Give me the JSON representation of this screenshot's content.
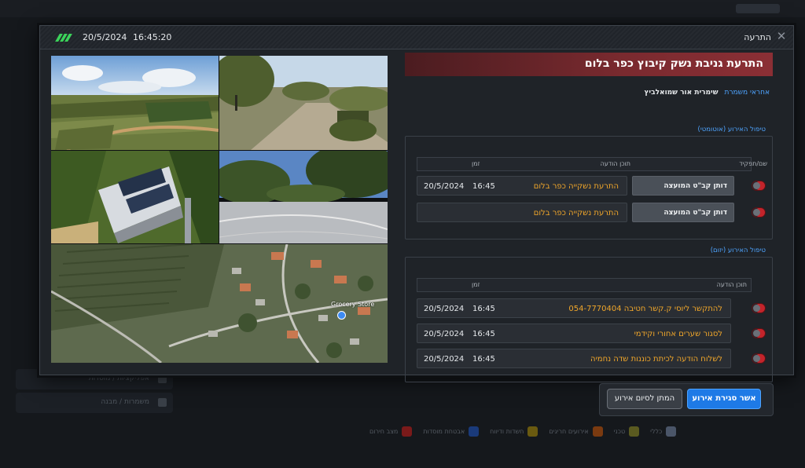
{
  "background": {
    "sidebar_items": [
      "אפליקציות / מוסדות",
      "משמרות / מבנה"
    ],
    "legend": [
      {
        "label": "כללי",
        "color": "#4a5568"
      },
      {
        "label": "טכני",
        "color": "#5a5a20"
      },
      {
        "label": "אירועים חריגים",
        "color": "#7a3a10"
      },
      {
        "label": "חשדות ודיווח",
        "color": "#6a5a10"
      },
      {
        "label": "אבטחת מוסדות",
        "color": "#1a3a7a"
      },
      {
        "label": "מצב חירום",
        "color": "#7a1a1a"
      }
    ]
  },
  "titlebar": {
    "date": "20/5/2024",
    "time": "16:45:20",
    "title": "התרעה",
    "close_icon": "close-icon"
  },
  "event": {
    "title": "התרעת גניבת נשק קיבוץ כפר בלום",
    "guard_label": "אחראי משמרת",
    "guard_name": "שימרית אור שמואלביץ"
  },
  "auto_handling": {
    "title": "טיפול האירוע (אוטומטי)",
    "col_role": "שם/תפקיד",
    "col_message": "תוכן הודעה",
    "col_time": "זמן",
    "rows": [
      {
        "role": "דותן קב\"ט המועצה",
        "message": "התרעת נשקייה כפר בלום",
        "time": "16:45",
        "date": "20/5/2024"
      },
      {
        "role": "דותן קב\"ט המועצה",
        "message": "התרעת נשקייה כפר בלום",
        "time": "",
        "date": ""
      }
    ]
  },
  "manual_handling": {
    "title": "טיפול האירוע (יזום)",
    "col_message": "תוכן הודעה",
    "col_time": "זמן",
    "rows": [
      {
        "message": "להתקשר ליוסי ק.קשר חטיבה 054-7770404",
        "time": "16:45",
        "date": "20/5/2024"
      },
      {
        "message": "לסגור שערים אחורי וקידמי",
        "time": "16:45",
        "date": "20/5/2024"
      },
      {
        "message": "לשלוח הודעה לכיתת כוננות שדה נחמיה",
        "time": "16:45",
        "date": "20/5/2024"
      }
    ]
  },
  "map": {
    "poi_label": "Grocery Store"
  },
  "buttons": {
    "confirm_close": "אשר סגירת אירוע",
    "wait_close": "המתן לסיום אירוע"
  },
  "colors": {
    "accent": "#1e7ae6",
    "alert": "#c3242b",
    "message_text": "#f0a62a",
    "section_title": "#4ea4ff"
  }
}
